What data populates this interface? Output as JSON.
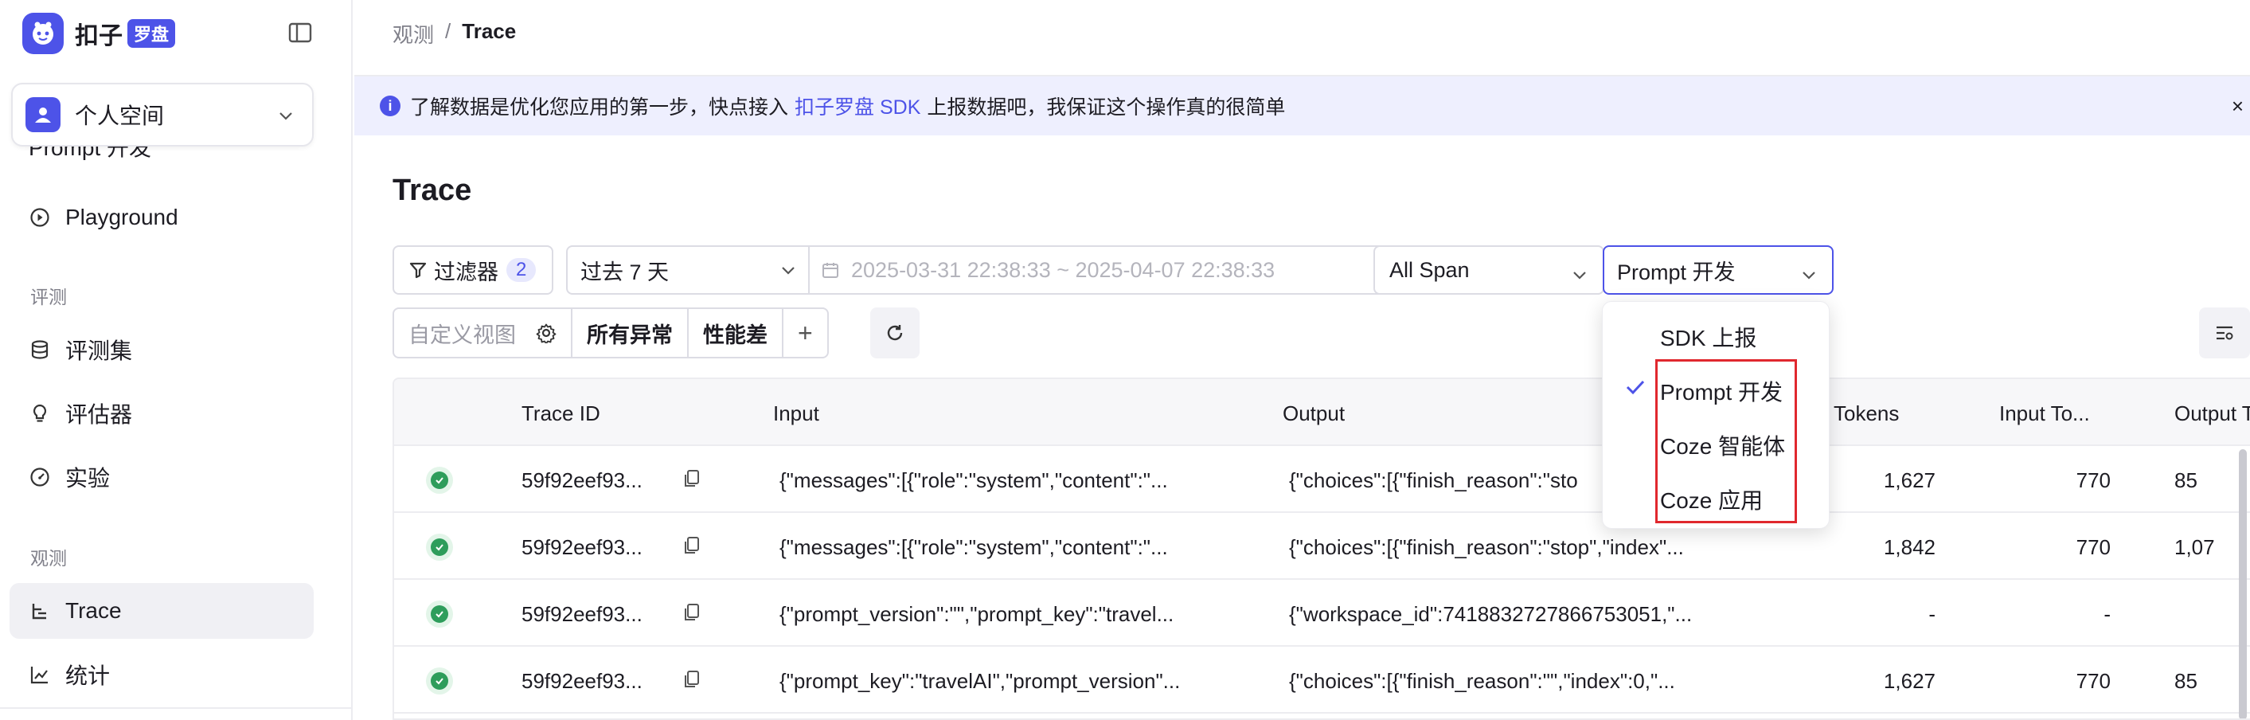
{
  "brand": {
    "name": "扣子",
    "tag": "罗盘"
  },
  "workspace": {
    "name": "个人空间"
  },
  "sidebar": {
    "clipped_item": "Prompt 开发",
    "items": [
      {
        "label": "Playground",
        "icon": "play-circle-icon"
      },
      {
        "section": "评测"
      },
      {
        "label": "评测集",
        "icon": "database-icon"
      },
      {
        "label": "评估器",
        "icon": "bulb-icon"
      },
      {
        "label": "实验",
        "icon": "gauge-icon"
      },
      {
        "section": "观测"
      },
      {
        "label": "Trace",
        "icon": "trace-icon",
        "active": true
      },
      {
        "label": "统计",
        "icon": "chart-icon"
      }
    ]
  },
  "breadcrumb": {
    "parent": "观测",
    "sep": "/",
    "current": "Trace"
  },
  "banner": {
    "text_before": "了解数据是优化您应用的第一步，快点接入",
    "link": "扣子罗盘 SDK",
    "text_after": "上报数据吧，我保证这个操作真的很简单",
    "close": "×"
  },
  "page_title": "Trace",
  "toolbar": {
    "filter_label": "过滤器",
    "filter_count": "2",
    "time_preset": "过去 7 天",
    "time_range": "2025-03-31 22:38:33 ~ 2025-04-07 22:38:33",
    "span_type": "All Span",
    "platform": "Prompt 开发",
    "custom_view_placeholder": "自定义视图",
    "view_all_errors": "所有异常",
    "view_poor_perf": "性能差",
    "add": "+"
  },
  "table": {
    "columns": [
      "Trace ID",
      "Input",
      "Output",
      "Tokens",
      "Input To...",
      "Output T..."
    ],
    "rows": [
      {
        "status": "success",
        "trace_id": "59f92eef93...",
        "input": "{\"messages\":[{\"role\":\"system\",\"content\":\"...",
        "output": "{\"choices\":[{\"finish_reason\":\"sto",
        "tokens": "1,627",
        "input_tokens": "770",
        "output_tokens": "85"
      },
      {
        "status": "success",
        "trace_id": "59f92eef93...",
        "input": "{\"messages\":[{\"role\":\"system\",\"content\":\"...",
        "output": "{\"choices\":[{\"finish_reason\":\"stop\",\"index\"...",
        "tokens": "1,842",
        "input_tokens": "770",
        "output_tokens": "1,07"
      },
      {
        "status": "success",
        "trace_id": "59f92eef93...",
        "input": "{\"prompt_version\":\"\",\"prompt_key\":\"travel...",
        "output": "{\"workspace_id\":7418832727866753051,\"...",
        "tokens": "-",
        "input_tokens": "-",
        "output_tokens": ""
      },
      {
        "status": "success",
        "trace_id": "59f92eef93...",
        "input": "{\"prompt_key\":\"travelAI\",\"prompt_version\"...",
        "output": "{\"choices\":[{\"finish_reason\":\"\",\"index\":0,\"...",
        "tokens": "1,627",
        "input_tokens": "770",
        "output_tokens": "85"
      }
    ]
  },
  "dropdown": {
    "options": [
      "SDK 上报",
      "Prompt 开发",
      "Coze 智能体",
      "Coze 应用"
    ],
    "selected": "Prompt 开发"
  },
  "colors": {
    "accent": "#4d53e8",
    "success": "#2e9d5b",
    "highlight_box": "#e0282e",
    "banner_bg": "#eeeffe"
  }
}
